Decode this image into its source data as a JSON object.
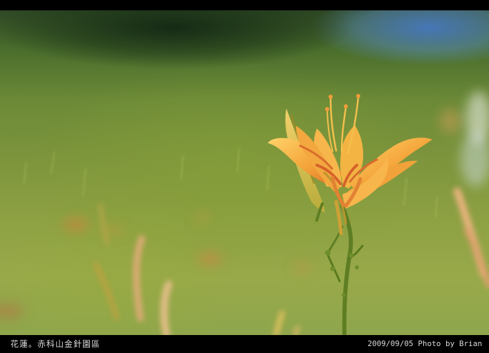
{
  "caption": {
    "left": "花蓮。赤科山金針園區",
    "right": "2009/09/05 Photo by Brian"
  },
  "colors": {
    "background": "#000000",
    "grass": "#8ea143",
    "flower": "#f0a53a",
    "flower_center": "#d56d2b",
    "sky": "#5f8fc7"
  },
  "icons": {
    "flower": "daylily-flower-icon"
  }
}
